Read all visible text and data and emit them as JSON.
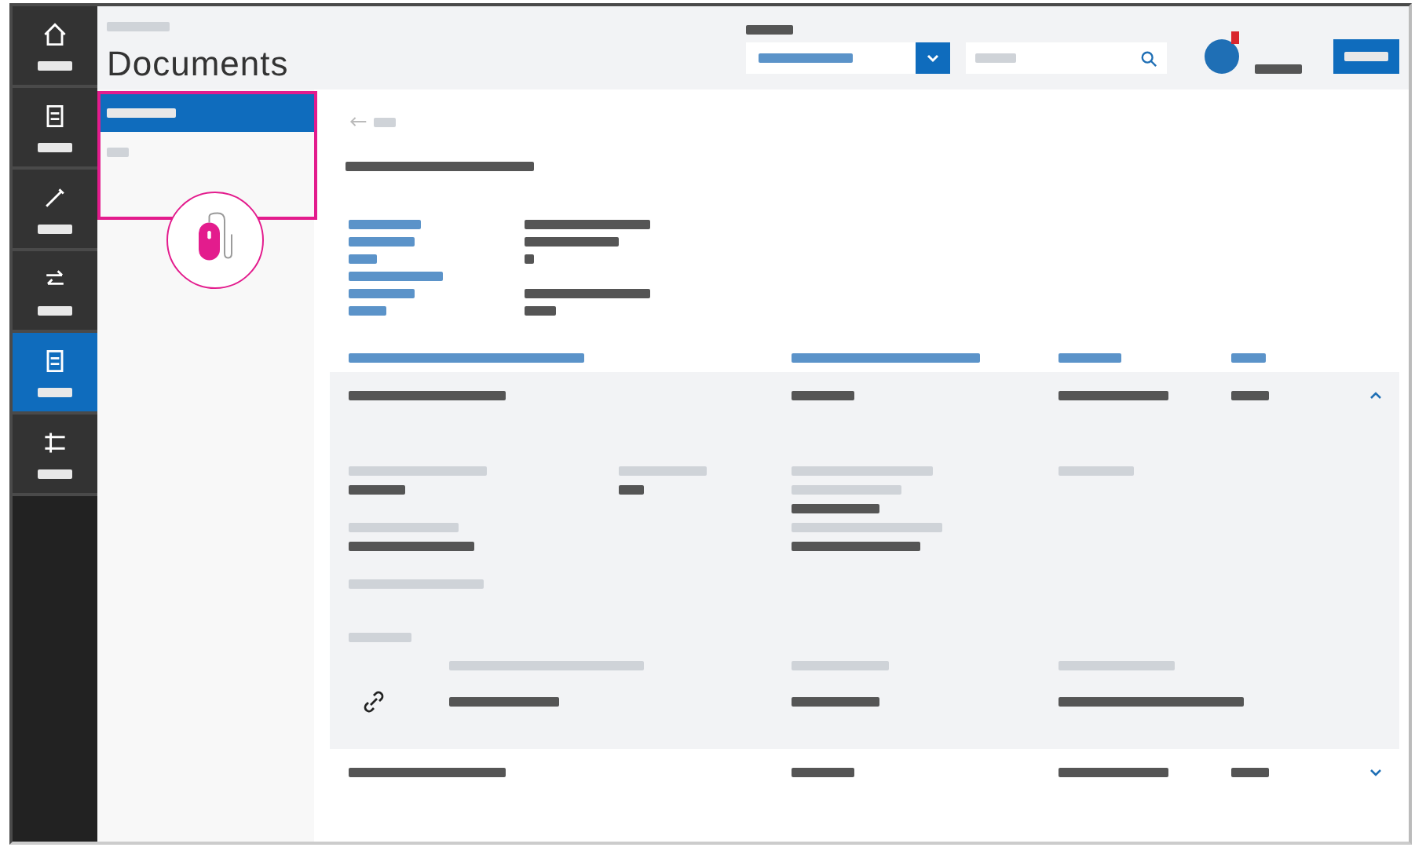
{
  "header": {
    "title": "Documents",
    "notification": true
  },
  "nav": [
    {
      "selected": false
    },
    {
      "selected": false
    },
    {
      "selected": false
    },
    {
      "selected": false
    },
    {
      "selected": true
    },
    {
      "selected": false
    }
  ],
  "submenu": [
    {
      "selected": true
    },
    {
      "selected": false
    }
  ],
  "rows": [
    {
      "expanded": true
    },
    {
      "expanded": false
    }
  ]
}
